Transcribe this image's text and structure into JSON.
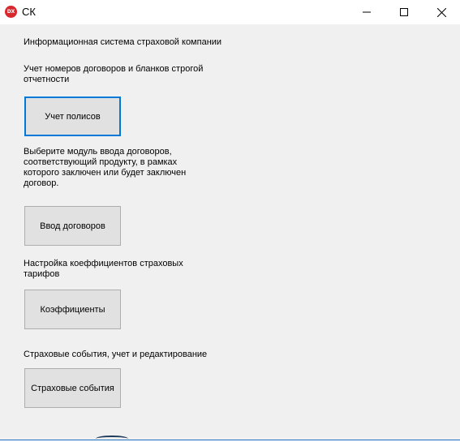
{
  "window": {
    "title": "СК",
    "icon_label": "DX",
    "icon_name": "devexpress-app-icon",
    "controls": [
      "minimize-icon",
      "maximize-icon",
      "close-icon"
    ]
  },
  "main": {
    "heading": "Информационная система страховой компании",
    "policies": {
      "description": "Учет номеров договоров и бланков строгой отчетности",
      "button_label": "Учет полисов"
    },
    "contracts": {
      "description": "Выберите модуль ввода договоров, соответствующий продукту, в рамках которого заключен или будет заключен договор.",
      "button_label": "Ввод договоров"
    },
    "coefficients": {
      "description": "Настройка коеффициентов страховых тарифов",
      "button_label": "Коэффициенты"
    },
    "events": {
      "description": "Страховые события, учет и редактирование",
      "button_label": "Страховые события"
    }
  },
  "colors": {
    "focus_border": "#0078d7",
    "button_bg": "#e1e1e1",
    "window_bg": "#f0f0f0",
    "icon_red": "#d9272e"
  }
}
